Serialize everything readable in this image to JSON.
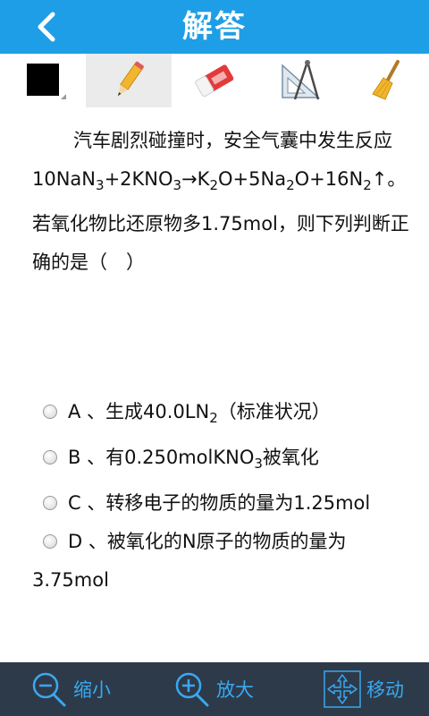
{
  "header": {
    "title": "解答"
  },
  "toolbar": {
    "tools": [
      {
        "name": "color-picker"
      },
      {
        "name": "pencil"
      },
      {
        "name": "eraser"
      },
      {
        "name": "ruler-compass"
      },
      {
        "name": "broom"
      }
    ],
    "active_index": 1
  },
  "question": {
    "line1": "汽车剧烈碰撞时，安全气囊中发生反应",
    "eq_p1": "10NaN",
    "eq_s1": "3",
    "eq_p2": "+2KNO",
    "eq_s2": "3",
    "eq_p3": "→K",
    "eq_s3": "2",
    "eq_p4": "O+5Na",
    "eq_s4": "2",
    "eq_p5": "O+16N",
    "eq_s5": "2",
    "eq_p6": "↑。",
    "line3": "若氧化物比还原物多1.75mol，则下列判断正确的是（　）"
  },
  "options": {
    "a_pre": "A 、生成40.0LN",
    "a_sub": "2",
    "a_post": "（标准状况）",
    "b_pre": "B 、有0.250molKNO",
    "b_sub": "3",
    "b_post": "被氧化",
    "c": "C 、转移电子的物质的量为1.25mol",
    "d": "D 、被氧化的N原子的物质的量为",
    "d_wrap": "3.75mol"
  },
  "bottom": {
    "zoom_out": "缩小",
    "zoom_in": "放大",
    "move": "移动"
  },
  "colors": {
    "header_bg": "#1e9ee6",
    "bottom_bg": "#2d3a4a",
    "accent": "#3aa8f0"
  }
}
